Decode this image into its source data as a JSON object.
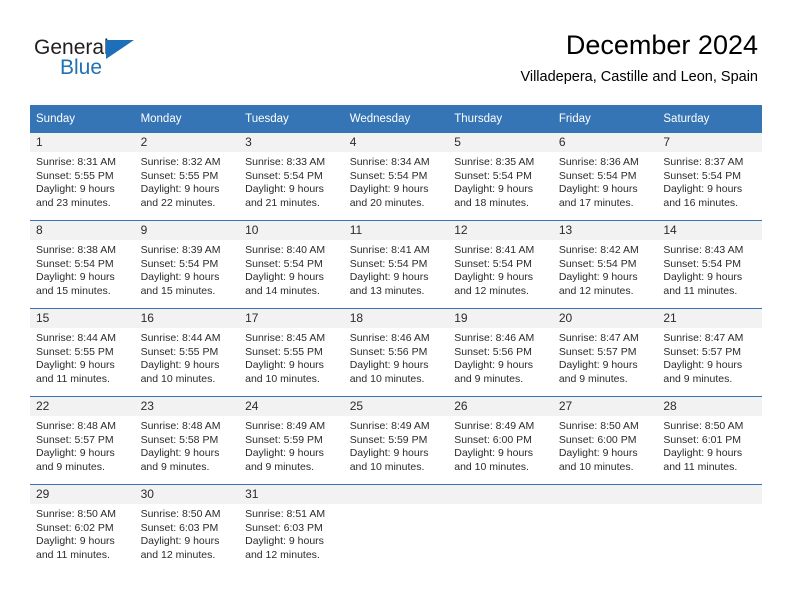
{
  "brand": {
    "name_top": "General",
    "name_bottom": "Blue",
    "triangle_icon": "blue-triangle-icon",
    "accent_color": "#2271b6"
  },
  "header": {
    "title": "December 2024",
    "subtitle": "Villadepera, Castille and Leon, Spain"
  },
  "colors": {
    "header_row_bg": "#3575b5",
    "day_band_bg": "#f2f2f2",
    "row_rule": "#3575b5",
    "text": "#2b2b2b"
  },
  "weekdays": [
    "Sunday",
    "Monday",
    "Tuesday",
    "Wednesday",
    "Thursday",
    "Friday",
    "Saturday"
  ],
  "weeks": [
    [
      {
        "day": "1",
        "sunrise": "Sunrise: 8:31 AM",
        "sunset": "Sunset: 5:55 PM",
        "daylight1": "Daylight: 9 hours",
        "daylight2": "and 23 minutes."
      },
      {
        "day": "2",
        "sunrise": "Sunrise: 8:32 AM",
        "sunset": "Sunset: 5:55 PM",
        "daylight1": "Daylight: 9 hours",
        "daylight2": "and 22 minutes."
      },
      {
        "day": "3",
        "sunrise": "Sunrise: 8:33 AM",
        "sunset": "Sunset: 5:54 PM",
        "daylight1": "Daylight: 9 hours",
        "daylight2": "and 21 minutes."
      },
      {
        "day": "4",
        "sunrise": "Sunrise: 8:34 AM",
        "sunset": "Sunset: 5:54 PM",
        "daylight1": "Daylight: 9 hours",
        "daylight2": "and 20 minutes."
      },
      {
        "day": "5",
        "sunrise": "Sunrise: 8:35 AM",
        "sunset": "Sunset: 5:54 PM",
        "daylight1": "Daylight: 9 hours",
        "daylight2": "and 18 minutes."
      },
      {
        "day": "6",
        "sunrise": "Sunrise: 8:36 AM",
        "sunset": "Sunset: 5:54 PM",
        "daylight1": "Daylight: 9 hours",
        "daylight2": "and 17 minutes."
      },
      {
        "day": "7",
        "sunrise": "Sunrise: 8:37 AM",
        "sunset": "Sunset: 5:54 PM",
        "daylight1": "Daylight: 9 hours",
        "daylight2": "and 16 minutes."
      }
    ],
    [
      {
        "day": "8",
        "sunrise": "Sunrise: 8:38 AM",
        "sunset": "Sunset: 5:54 PM",
        "daylight1": "Daylight: 9 hours",
        "daylight2": "and 15 minutes."
      },
      {
        "day": "9",
        "sunrise": "Sunrise: 8:39 AM",
        "sunset": "Sunset: 5:54 PM",
        "daylight1": "Daylight: 9 hours",
        "daylight2": "and 15 minutes."
      },
      {
        "day": "10",
        "sunrise": "Sunrise: 8:40 AM",
        "sunset": "Sunset: 5:54 PM",
        "daylight1": "Daylight: 9 hours",
        "daylight2": "and 14 minutes."
      },
      {
        "day": "11",
        "sunrise": "Sunrise: 8:41 AM",
        "sunset": "Sunset: 5:54 PM",
        "daylight1": "Daylight: 9 hours",
        "daylight2": "and 13 minutes."
      },
      {
        "day": "12",
        "sunrise": "Sunrise: 8:41 AM",
        "sunset": "Sunset: 5:54 PM",
        "daylight1": "Daylight: 9 hours",
        "daylight2": "and 12 minutes."
      },
      {
        "day": "13",
        "sunrise": "Sunrise: 8:42 AM",
        "sunset": "Sunset: 5:54 PM",
        "daylight1": "Daylight: 9 hours",
        "daylight2": "and 12 minutes."
      },
      {
        "day": "14",
        "sunrise": "Sunrise: 8:43 AM",
        "sunset": "Sunset: 5:54 PM",
        "daylight1": "Daylight: 9 hours",
        "daylight2": "and 11 minutes."
      }
    ],
    [
      {
        "day": "15",
        "sunrise": "Sunrise: 8:44 AM",
        "sunset": "Sunset: 5:55 PM",
        "daylight1": "Daylight: 9 hours",
        "daylight2": "and 11 minutes."
      },
      {
        "day": "16",
        "sunrise": "Sunrise: 8:44 AM",
        "sunset": "Sunset: 5:55 PM",
        "daylight1": "Daylight: 9 hours",
        "daylight2": "and 10 minutes."
      },
      {
        "day": "17",
        "sunrise": "Sunrise: 8:45 AM",
        "sunset": "Sunset: 5:55 PM",
        "daylight1": "Daylight: 9 hours",
        "daylight2": "and 10 minutes."
      },
      {
        "day": "18",
        "sunrise": "Sunrise: 8:46 AM",
        "sunset": "Sunset: 5:56 PM",
        "daylight1": "Daylight: 9 hours",
        "daylight2": "and 10 minutes."
      },
      {
        "day": "19",
        "sunrise": "Sunrise: 8:46 AM",
        "sunset": "Sunset: 5:56 PM",
        "daylight1": "Daylight: 9 hours",
        "daylight2": "and 9 minutes."
      },
      {
        "day": "20",
        "sunrise": "Sunrise: 8:47 AM",
        "sunset": "Sunset: 5:57 PM",
        "daylight1": "Daylight: 9 hours",
        "daylight2": "and 9 minutes."
      },
      {
        "day": "21",
        "sunrise": "Sunrise: 8:47 AM",
        "sunset": "Sunset: 5:57 PM",
        "daylight1": "Daylight: 9 hours",
        "daylight2": "and 9 minutes."
      }
    ],
    [
      {
        "day": "22",
        "sunrise": "Sunrise: 8:48 AM",
        "sunset": "Sunset: 5:57 PM",
        "daylight1": "Daylight: 9 hours",
        "daylight2": "and 9 minutes."
      },
      {
        "day": "23",
        "sunrise": "Sunrise: 8:48 AM",
        "sunset": "Sunset: 5:58 PM",
        "daylight1": "Daylight: 9 hours",
        "daylight2": "and 9 minutes."
      },
      {
        "day": "24",
        "sunrise": "Sunrise: 8:49 AM",
        "sunset": "Sunset: 5:59 PM",
        "daylight1": "Daylight: 9 hours",
        "daylight2": "and 9 minutes."
      },
      {
        "day": "25",
        "sunrise": "Sunrise: 8:49 AM",
        "sunset": "Sunset: 5:59 PM",
        "daylight1": "Daylight: 9 hours",
        "daylight2": "and 10 minutes."
      },
      {
        "day": "26",
        "sunrise": "Sunrise: 8:49 AM",
        "sunset": "Sunset: 6:00 PM",
        "daylight1": "Daylight: 9 hours",
        "daylight2": "and 10 minutes."
      },
      {
        "day": "27",
        "sunrise": "Sunrise: 8:50 AM",
        "sunset": "Sunset: 6:00 PM",
        "daylight1": "Daylight: 9 hours",
        "daylight2": "and 10 minutes."
      },
      {
        "day": "28",
        "sunrise": "Sunrise: 8:50 AM",
        "sunset": "Sunset: 6:01 PM",
        "daylight1": "Daylight: 9 hours",
        "daylight2": "and 11 minutes."
      }
    ],
    [
      {
        "day": "29",
        "sunrise": "Sunrise: 8:50 AM",
        "sunset": "Sunset: 6:02 PM",
        "daylight1": "Daylight: 9 hours",
        "daylight2": "and 11 minutes."
      },
      {
        "day": "30",
        "sunrise": "Sunrise: 8:50 AM",
        "sunset": "Sunset: 6:03 PM",
        "daylight1": "Daylight: 9 hours",
        "daylight2": "and 12 minutes."
      },
      {
        "day": "31",
        "sunrise": "Sunrise: 8:51 AM",
        "sunset": "Sunset: 6:03 PM",
        "daylight1": "Daylight: 9 hours",
        "daylight2": "and 12 minutes."
      },
      {
        "day": "",
        "sunrise": "",
        "sunset": "",
        "daylight1": "",
        "daylight2": ""
      },
      {
        "day": "",
        "sunrise": "",
        "sunset": "",
        "daylight1": "",
        "daylight2": ""
      },
      {
        "day": "",
        "sunrise": "",
        "sunset": "",
        "daylight1": "",
        "daylight2": ""
      },
      {
        "day": "",
        "sunrise": "",
        "sunset": "",
        "daylight1": "",
        "daylight2": ""
      }
    ]
  ]
}
